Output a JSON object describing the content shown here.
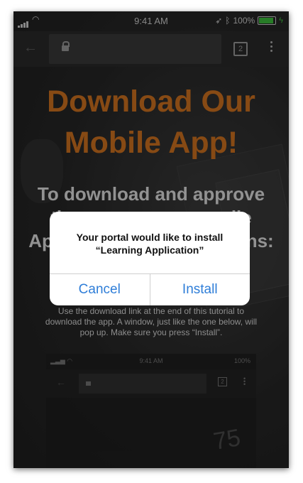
{
  "status_bar": {
    "time": "9:41 AM",
    "battery": "100%",
    "wifi_icon": "wifi-icon",
    "location_icon": "location-arrow-icon",
    "bluetooth_icon": "bluetooth-icon"
  },
  "browser": {
    "tab_count": "2",
    "back_icon": "back-arrow-icon",
    "lock_icon": "lock-icon",
    "menu_icon": "overflow-menu-icon"
  },
  "page": {
    "headline_line1": "Download Our",
    "headline_line2": "Mobile App!",
    "subhead_line1": "To download and approve",
    "subhead_line2_left": "th",
    "subhead_line2_right": "ile",
    "subhead_line3_left": "App",
    "subhead_line3_right": "ons:",
    "body_text": "Use the download link at the end of this tutorial to download the app.  A window, just like the one below, will pop up. Make sure you press “Install”."
  },
  "mini_screenshot": {
    "time": "9:41 AM",
    "battery": "100%",
    "tab_count": "2",
    "number": "75"
  },
  "dialog": {
    "message_line1": "Your portal would like to install",
    "message_line2": "“Learning Application”",
    "cancel_label": "Cancel",
    "install_label": "Install"
  },
  "colors": {
    "headline": "#d0721f",
    "button_text": "#2f7ed8",
    "battery_fill": "#3dbf3d"
  }
}
